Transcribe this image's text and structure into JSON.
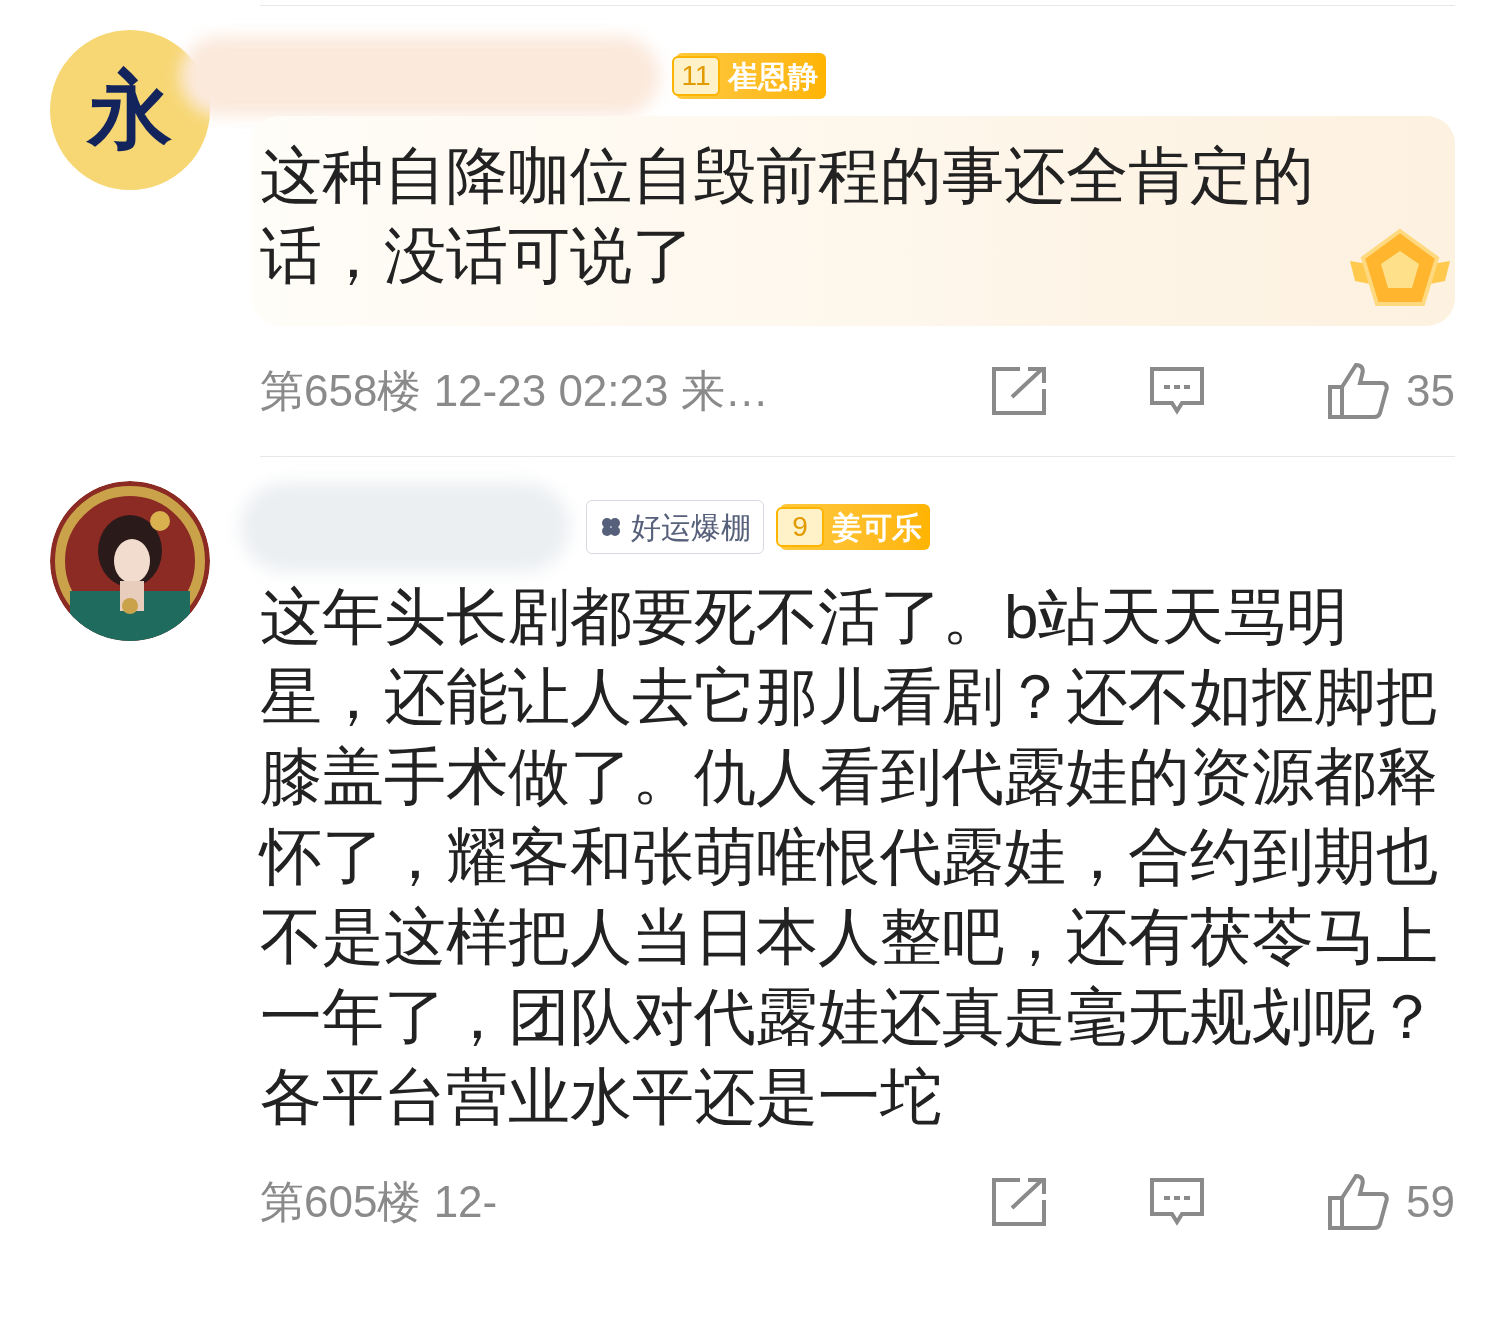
{
  "comments": [
    {
      "avatar": {
        "kind": "letter",
        "text": "永"
      },
      "tags": [
        {
          "kind": "fan",
          "level": "11",
          "name": "崔恩静"
        }
      ],
      "highlighted": true,
      "text": "这种自降咖位自毁前程的事还全肯定的话，没话可说了",
      "meta": "第658楼 12-23 02:23 来…",
      "likes": "35"
    },
    {
      "tags": [
        {
          "kind": "status",
          "name": "好运爆棚"
        },
        {
          "kind": "fan",
          "level": "9",
          "name": "姜可乐"
        }
      ],
      "highlighted": false,
      "text": "这年头长剧都要死不活了。b站天天骂明星，还能让人去它那儿看剧？还不如抠脚把膝盖手术做了。仇人看到代露娃的资源都释怀了，耀客和张萌唯恨代露娃，合约到期也不是这样把人当日本人整吧，还有茯苓马上一年了，团队对代露娃还真是毫无规划呢？各平台营业水平还是一坨",
      "meta": "第605楼 12-",
      "likes": "59"
    }
  ]
}
